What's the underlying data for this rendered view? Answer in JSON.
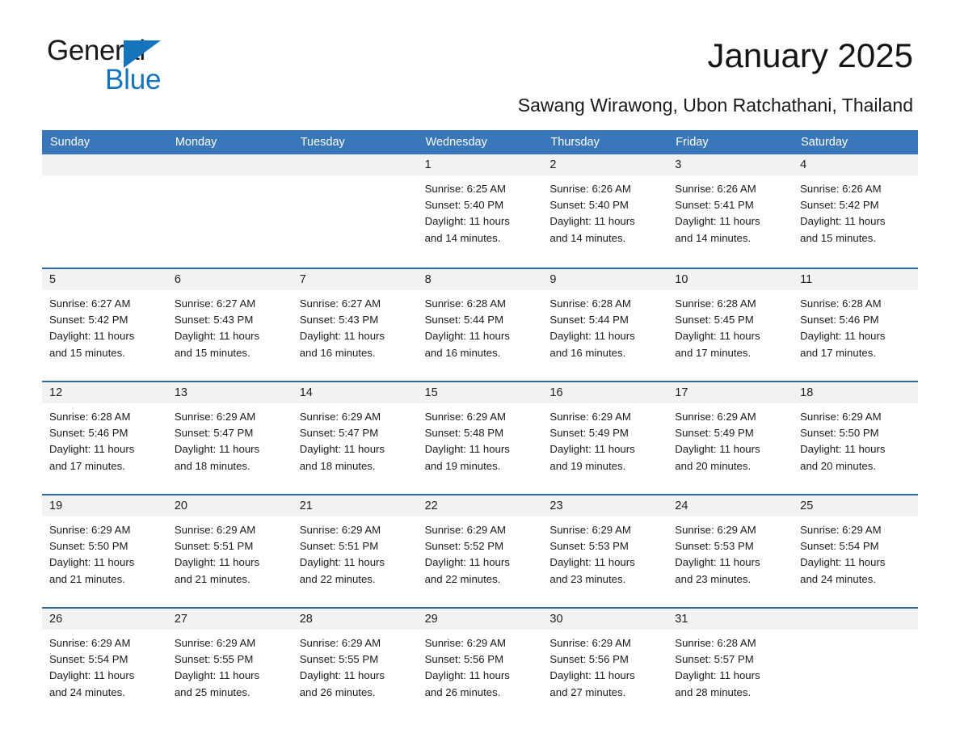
{
  "brand": {
    "name_part1": "General",
    "name_part2": "Blue"
  },
  "header": {
    "month_title": "January 2025",
    "location": "Sawang Wirawong, Ubon Ratchathani, Thailand"
  },
  "colors": {
    "header_blue": "#3a76ba",
    "row_rule_blue": "#2e6aa8",
    "daynum_band": "#f2f2f2",
    "brand_blue": "#1574bb"
  },
  "weekdays": [
    "Sunday",
    "Monday",
    "Tuesday",
    "Wednesday",
    "Thursday",
    "Friday",
    "Saturday"
  ],
  "weeks": [
    [
      {
        "day": "",
        "sunrise": "",
        "sunset": "",
        "daylight_line1": "",
        "daylight_line2": "",
        "empty": true
      },
      {
        "day": "",
        "sunrise": "",
        "sunset": "",
        "daylight_line1": "",
        "daylight_line2": "",
        "empty": true
      },
      {
        "day": "",
        "sunrise": "",
        "sunset": "",
        "daylight_line1": "",
        "daylight_line2": "",
        "empty": true
      },
      {
        "day": "1",
        "sunrise": "Sunrise: 6:25 AM",
        "sunset": "Sunset: 5:40 PM",
        "daylight_line1": "Daylight: 11 hours",
        "daylight_line2": "and 14 minutes."
      },
      {
        "day": "2",
        "sunrise": "Sunrise: 6:26 AM",
        "sunset": "Sunset: 5:40 PM",
        "daylight_line1": "Daylight: 11 hours",
        "daylight_line2": "and 14 minutes."
      },
      {
        "day": "3",
        "sunrise": "Sunrise: 6:26 AM",
        "sunset": "Sunset: 5:41 PM",
        "daylight_line1": "Daylight: 11 hours",
        "daylight_line2": "and 14 minutes."
      },
      {
        "day": "4",
        "sunrise": "Sunrise: 6:26 AM",
        "sunset": "Sunset: 5:42 PM",
        "daylight_line1": "Daylight: 11 hours",
        "daylight_line2": "and 15 minutes."
      }
    ],
    [
      {
        "day": "5",
        "sunrise": "Sunrise: 6:27 AM",
        "sunset": "Sunset: 5:42 PM",
        "daylight_line1": "Daylight: 11 hours",
        "daylight_line2": "and 15 minutes."
      },
      {
        "day": "6",
        "sunrise": "Sunrise: 6:27 AM",
        "sunset": "Sunset: 5:43 PM",
        "daylight_line1": "Daylight: 11 hours",
        "daylight_line2": "and 15 minutes."
      },
      {
        "day": "7",
        "sunrise": "Sunrise: 6:27 AM",
        "sunset": "Sunset: 5:43 PM",
        "daylight_line1": "Daylight: 11 hours",
        "daylight_line2": "and 16 minutes."
      },
      {
        "day": "8",
        "sunrise": "Sunrise: 6:28 AM",
        "sunset": "Sunset: 5:44 PM",
        "daylight_line1": "Daylight: 11 hours",
        "daylight_line2": "and 16 minutes."
      },
      {
        "day": "9",
        "sunrise": "Sunrise: 6:28 AM",
        "sunset": "Sunset: 5:44 PM",
        "daylight_line1": "Daylight: 11 hours",
        "daylight_line2": "and 16 minutes."
      },
      {
        "day": "10",
        "sunrise": "Sunrise: 6:28 AM",
        "sunset": "Sunset: 5:45 PM",
        "daylight_line1": "Daylight: 11 hours",
        "daylight_line2": "and 17 minutes."
      },
      {
        "day": "11",
        "sunrise": "Sunrise: 6:28 AM",
        "sunset": "Sunset: 5:46 PM",
        "daylight_line1": "Daylight: 11 hours",
        "daylight_line2": "and 17 minutes."
      }
    ],
    [
      {
        "day": "12",
        "sunrise": "Sunrise: 6:28 AM",
        "sunset": "Sunset: 5:46 PM",
        "daylight_line1": "Daylight: 11 hours",
        "daylight_line2": "and 17 minutes."
      },
      {
        "day": "13",
        "sunrise": "Sunrise: 6:29 AM",
        "sunset": "Sunset: 5:47 PM",
        "daylight_line1": "Daylight: 11 hours",
        "daylight_line2": "and 18 minutes."
      },
      {
        "day": "14",
        "sunrise": "Sunrise: 6:29 AM",
        "sunset": "Sunset: 5:47 PM",
        "daylight_line1": "Daylight: 11 hours",
        "daylight_line2": "and 18 minutes."
      },
      {
        "day": "15",
        "sunrise": "Sunrise: 6:29 AM",
        "sunset": "Sunset: 5:48 PM",
        "daylight_line1": "Daylight: 11 hours",
        "daylight_line2": "and 19 minutes."
      },
      {
        "day": "16",
        "sunrise": "Sunrise: 6:29 AM",
        "sunset": "Sunset: 5:49 PM",
        "daylight_line1": "Daylight: 11 hours",
        "daylight_line2": "and 19 minutes."
      },
      {
        "day": "17",
        "sunrise": "Sunrise: 6:29 AM",
        "sunset": "Sunset: 5:49 PM",
        "daylight_line1": "Daylight: 11 hours",
        "daylight_line2": "and 20 minutes."
      },
      {
        "day": "18",
        "sunrise": "Sunrise: 6:29 AM",
        "sunset": "Sunset: 5:50 PM",
        "daylight_line1": "Daylight: 11 hours",
        "daylight_line2": "and 20 minutes."
      }
    ],
    [
      {
        "day": "19",
        "sunrise": "Sunrise: 6:29 AM",
        "sunset": "Sunset: 5:50 PM",
        "daylight_line1": "Daylight: 11 hours",
        "daylight_line2": "and 21 minutes."
      },
      {
        "day": "20",
        "sunrise": "Sunrise: 6:29 AM",
        "sunset": "Sunset: 5:51 PM",
        "daylight_line1": "Daylight: 11 hours",
        "daylight_line2": "and 21 minutes."
      },
      {
        "day": "21",
        "sunrise": "Sunrise: 6:29 AM",
        "sunset": "Sunset: 5:51 PM",
        "daylight_line1": "Daylight: 11 hours",
        "daylight_line2": "and 22 minutes."
      },
      {
        "day": "22",
        "sunrise": "Sunrise: 6:29 AM",
        "sunset": "Sunset: 5:52 PM",
        "daylight_line1": "Daylight: 11 hours",
        "daylight_line2": "and 22 minutes."
      },
      {
        "day": "23",
        "sunrise": "Sunrise: 6:29 AM",
        "sunset": "Sunset: 5:53 PM",
        "daylight_line1": "Daylight: 11 hours",
        "daylight_line2": "and 23 minutes."
      },
      {
        "day": "24",
        "sunrise": "Sunrise: 6:29 AM",
        "sunset": "Sunset: 5:53 PM",
        "daylight_line1": "Daylight: 11 hours",
        "daylight_line2": "and 23 minutes."
      },
      {
        "day": "25",
        "sunrise": "Sunrise: 6:29 AM",
        "sunset": "Sunset: 5:54 PM",
        "daylight_line1": "Daylight: 11 hours",
        "daylight_line2": "and 24 minutes."
      }
    ],
    [
      {
        "day": "26",
        "sunrise": "Sunrise: 6:29 AM",
        "sunset": "Sunset: 5:54 PM",
        "daylight_line1": "Daylight: 11 hours",
        "daylight_line2": "and 24 minutes."
      },
      {
        "day": "27",
        "sunrise": "Sunrise: 6:29 AM",
        "sunset": "Sunset: 5:55 PM",
        "daylight_line1": "Daylight: 11 hours",
        "daylight_line2": "and 25 minutes."
      },
      {
        "day": "28",
        "sunrise": "Sunrise: 6:29 AM",
        "sunset": "Sunset: 5:55 PM",
        "daylight_line1": "Daylight: 11 hours",
        "daylight_line2": "and 26 minutes."
      },
      {
        "day": "29",
        "sunrise": "Sunrise: 6:29 AM",
        "sunset": "Sunset: 5:56 PM",
        "daylight_line1": "Daylight: 11 hours",
        "daylight_line2": "and 26 minutes."
      },
      {
        "day": "30",
        "sunrise": "Sunrise: 6:29 AM",
        "sunset": "Sunset: 5:56 PM",
        "daylight_line1": "Daylight: 11 hours",
        "daylight_line2": "and 27 minutes."
      },
      {
        "day": "31",
        "sunrise": "Sunrise: 6:28 AM",
        "sunset": "Sunset: 5:57 PM",
        "daylight_line1": "Daylight: 11 hours",
        "daylight_line2": "and 28 minutes."
      },
      {
        "day": "",
        "sunrise": "",
        "sunset": "",
        "daylight_line1": "",
        "daylight_line2": "",
        "empty": true
      }
    ]
  ]
}
